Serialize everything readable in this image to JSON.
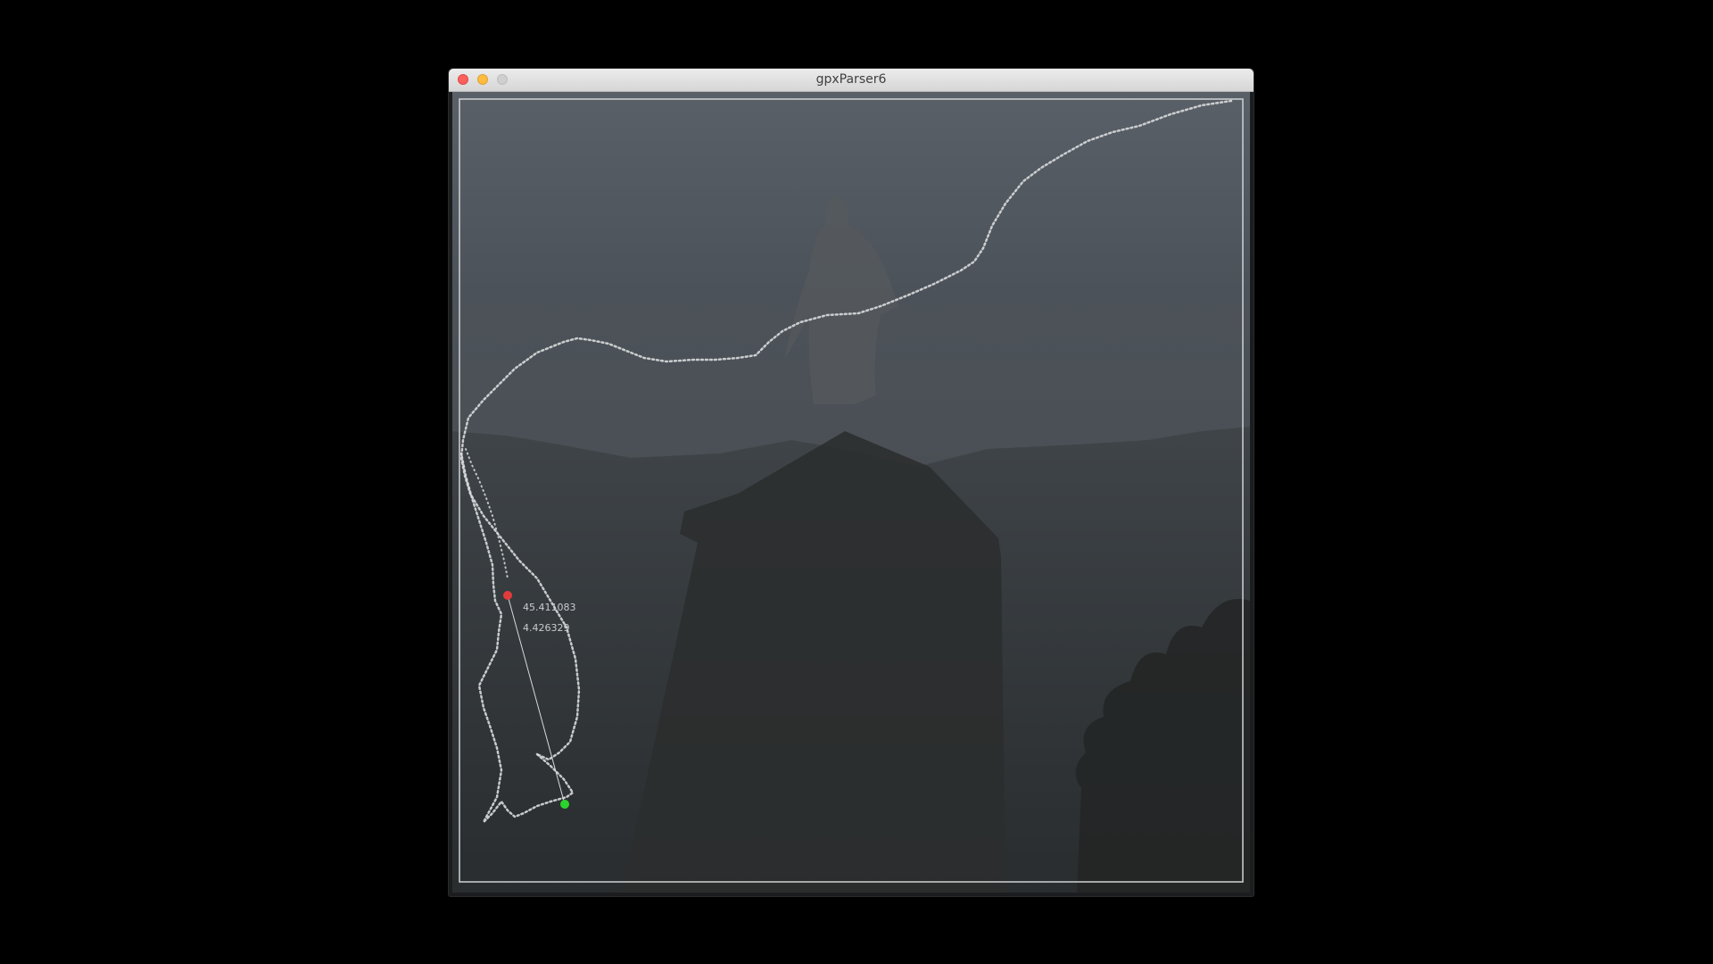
{
  "window": {
    "title": "gpxParser6"
  },
  "controls": {
    "close_icon": "close-circle-icon",
    "minimize_icon": "minimize-circle-icon",
    "zoom_icon": "zoom-circle-icon"
  },
  "map": {
    "marker_start_color": "#e23b3b",
    "marker_end_color": "#2bd42b",
    "track_color": "#d8dadc",
    "frame_color": "#d0d2d4",
    "coords": {
      "lat": "45.411083",
      "lon": "4.426329"
    }
  }
}
